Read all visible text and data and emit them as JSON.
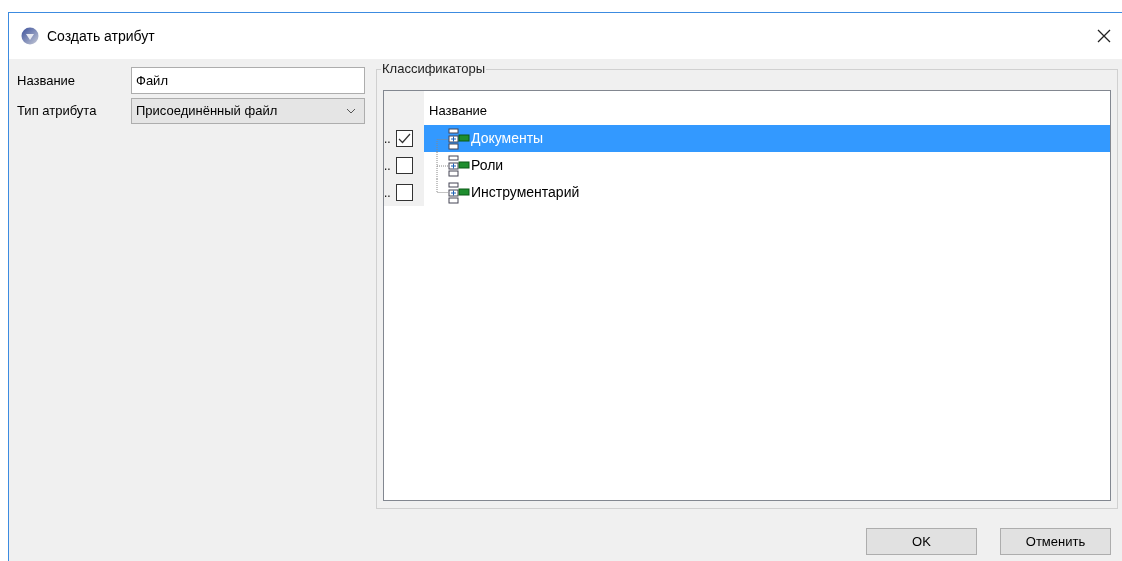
{
  "window": {
    "title": "Создать атрибут"
  },
  "fields": [
    {
      "label": "Название",
      "kind": "text",
      "value": "Файл"
    },
    {
      "label": "Тип атрибута",
      "kind": "dropdown",
      "value": "Присоединённый файл"
    }
  ],
  "classifiers": {
    "title": "Классификаторы",
    "column": "Название",
    "rows": [
      {
        "prefix": "..",
        "checked": true,
        "selected": true,
        "label": "Документы"
      },
      {
        "prefix": "..",
        "checked": false,
        "selected": false,
        "label": "Роли"
      },
      {
        "prefix": "..",
        "checked": false,
        "selected": false,
        "label": "Инструментарий"
      }
    ]
  },
  "buttons": [
    "OK",
    "Отменить"
  ]
}
